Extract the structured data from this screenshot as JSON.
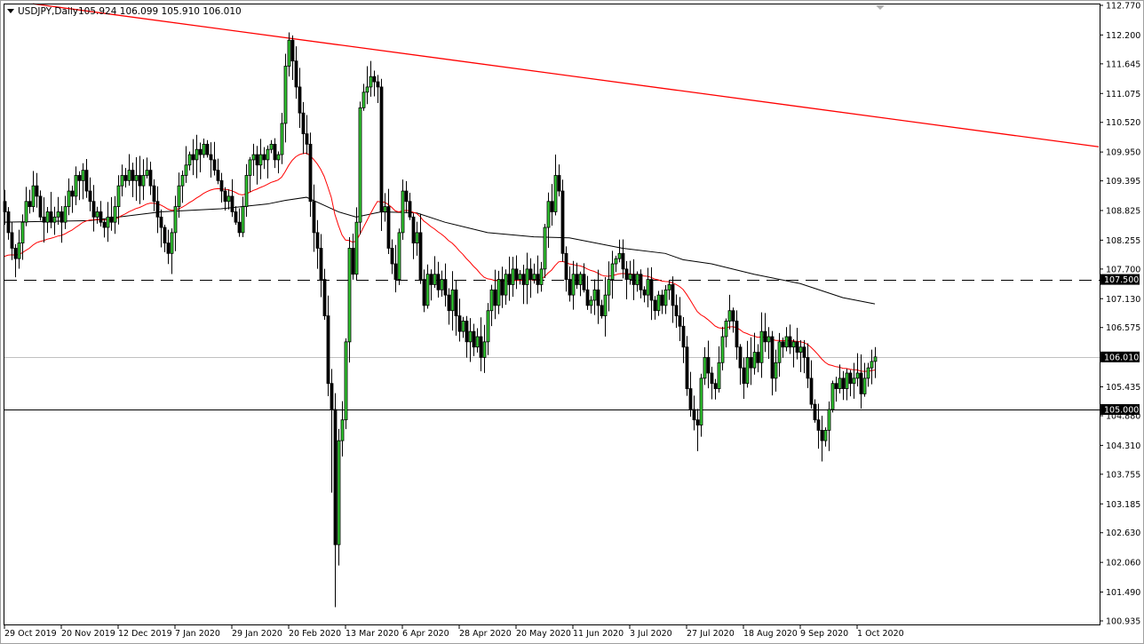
{
  "header": {
    "symbol_timeframe": "USDJPY,Daily",
    "ohlc": "105.924 106.099 105.910 106.010"
  },
  "colors": {
    "bull": "#32cd32",
    "bear": "#000000",
    "ma_fast": "#ff0000",
    "ma_slow": "#000000",
    "trendline": "#ff0000",
    "bid_line": "#c0c0c0"
  },
  "chart_data": {
    "type": "candlestick",
    "title": "USDJPY,Daily",
    "ylim": [
      100.935,
      112.77
    ],
    "y_ticks": [
      "112.770",
      "112.200",
      "111.645",
      "111.075",
      "110.520",
      "109.950",
      "109.395",
      "108.825",
      "108.255",
      "107.700",
      "107.130",
      "106.575",
      "105.435",
      "104.880",
      "104.310",
      "103.755",
      "103.185",
      "102.630",
      "102.060",
      "101.490",
      "100.935"
    ],
    "x_ticks": [
      {
        "index": 0,
        "label": "29 Oct 2019"
      },
      {
        "index": 16,
        "label": "20 Nov 2019"
      },
      {
        "index": 32,
        "label": "12 Dec 2019"
      },
      {
        "index": 48,
        "label": "7 Jan 2020"
      },
      {
        "index": 64,
        "label": "29 Jan 2020"
      },
      {
        "index": 80,
        "label": "20 Feb 2020"
      },
      {
        "index": 96,
        "label": "13 Mar 2020"
      },
      {
        "index": 112,
        "label": "6 Apr 2020"
      },
      {
        "index": 128,
        "label": "28 Apr 2020"
      },
      {
        "index": 144,
        "label": "20 May 2020"
      },
      {
        "index": 160,
        "label": "11 Jun 2020"
      },
      {
        "index": 176,
        "label": "3 Jul 2020"
      },
      {
        "index": 192,
        "label": "27 Jul 2020"
      },
      {
        "index": 208,
        "label": "18 Aug 2020"
      },
      {
        "index": 224,
        "label": "9 Sep 2020"
      },
      {
        "index": 240,
        "label": "1 Oct 2020"
      }
    ],
    "closes": [
      108.8,
      108.4,
      108.1,
      107.9,
      108.2,
      108.6,
      109.0,
      108.9,
      109.3,
      109.1,
      108.7,
      108.6,
      108.8,
      108.6,
      108.7,
      108.8,
      108.6,
      108.9,
      109.2,
      109.1,
      109.5,
      109.4,
      109.6,
      109.2,
      109.0,
      108.7,
      108.8,
      108.6,
      108.5,
      108.7,
      108.6,
      108.9,
      109.3,
      109.5,
      109.4,
      109.6,
      109.4,
      109.5,
      109.3,
      109.5,
      109.6,
      109.3,
      109.0,
      108.7,
      108.5,
      108.2,
      108.0,
      108.4,
      108.9,
      109.3,
      109.5,
      109.7,
      109.9,
      109.8,
      110.0,
      109.9,
      110.1,
      109.9,
      109.8,
      109.6,
      109.4,
      109.2,
      109.0,
      109.1,
      108.8,
      108.6,
      108.4,
      108.9,
      109.5,
      109.8,
      109.9,
      109.7,
      109.9,
      109.8,
      110.0,
      110.1,
      109.8,
      109.9,
      110.5,
      111.6,
      112.1,
      111.7,
      111.2,
      110.7,
      110.3,
      110.1,
      109.0,
      108.4,
      108.1,
      107.5,
      106.8,
      105.5,
      105.0,
      102.4,
      104.4,
      104.8,
      106.3,
      108.1,
      107.6,
      108.6,
      110.8,
      111.1,
      111.2,
      111.4,
      111.3,
      111.2,
      108.8,
      108.9,
      108.1,
      107.8,
      107.5,
      108.4,
      109.2,
      109.0,
      108.7,
      108.2,
      108.4,
      107.5,
      107.0,
      107.6,
      107.4,
      107.6,
      107.3,
      107.5,
      107.2,
      106.9,
      107.3,
      106.8,
      106.5,
      106.7,
      106.3,
      106.5,
      106.2,
      106.4,
      106.0,
      106.3,
      106.9,
      107.3,
      107.0,
      107.5,
      107.2,
      107.6,
      107.4,
      107.7,
      107.5,
      107.6,
      107.4,
      107.7,
      107.5,
      107.6,
      107.4,
      107.7,
      108.5,
      109.0,
      108.8,
      109.5,
      109.2,
      108.0,
      107.5,
      107.2,
      107.6,
      107.4,
      107.6,
      107.3,
      107.0,
      107.1,
      107.3,
      107.0,
      106.8,
      107.2,
      107.5,
      107.8,
      107.9,
      108.0,
      107.7,
      107.5,
      107.6,
      107.4,
      107.6,
      107.3,
      107.2,
      107.5,
      107.1,
      106.9,
      107.2,
      107.0,
      107.3,
      107.4,
      107.0,
      106.8,
      106.6,
      106.2,
      105.4,
      105.0,
      104.8,
      104.7,
      105.6,
      106.0,
      105.7,
      105.5,
      105.4,
      105.9,
      106.4,
      106.7,
      106.9,
      106.7,
      106.2,
      105.8,
      105.5,
      106.0,
      105.8,
      106.1,
      105.9,
      106.5,
      106.3,
      106.4,
      105.6,
      105.9,
      106.3,
      106.2,
      106.4,
      106.2,
      106.3,
      106.1,
      106.2,
      106.0,
      105.6,
      105.1,
      104.8,
      104.6,
      104.4,
      104.6,
      105.0,
      105.5,
      105.4,
      105.6,
      105.4,
      105.7,
      105.5,
      105.6,
      105.7,
      105.3,
      105.6,
      105.8,
      105.924,
      106.01
    ],
    "last_open": 105.924,
    "wick_overrides": [
      {
        "index": 80,
        "high": 112.25
      },
      {
        "index": 93,
        "low": 101.2
      },
      {
        "index": 94,
        "low": 102.0
      },
      {
        "index": 92,
        "low": 103.4
      },
      {
        "index": 103,
        "high": 111.7
      },
      {
        "index": 102,
        "high": 111.6
      },
      {
        "index": 155,
        "high": 109.9
      },
      {
        "index": 195,
        "low": 104.2
      },
      {
        "index": 230,
        "low": 104.0
      },
      {
        "index": 245,
        "high": 106.2
      }
    ],
    "ma_slow_points": [
      [
        0,
        108.6
      ],
      [
        24,
        108.63
      ],
      [
        44,
        108.8
      ],
      [
        61,
        108.86
      ],
      [
        74,
        108.95
      ],
      [
        79,
        109.02
      ],
      [
        85,
        109.08
      ],
      [
        94,
        108.8
      ],
      [
        99,
        108.7
      ],
      [
        106,
        108.8
      ],
      [
        116,
        108.78
      ],
      [
        124,
        108.6
      ],
      [
        136,
        108.4
      ],
      [
        149,
        108.32
      ],
      [
        159,
        108.3
      ],
      [
        174,
        108.1
      ],
      [
        186,
        108.0
      ],
      [
        191,
        107.88
      ],
      [
        199,
        107.8
      ],
      [
        211,
        107.6
      ],
      [
        224,
        107.42
      ],
      [
        236,
        107.15
      ],
      [
        245,
        107.03
      ]
    ],
    "ma_fast_period": 40,
    "ma_fast_seed": 107.9,
    "trendline": [
      [
        8,
        112.8
      ],
      [
        308,
        110.05
      ]
    ],
    "levels": [
      {
        "name": "resistance",
        "price": 107.5,
        "label": "107.500",
        "style": "dashed"
      },
      {
        "name": "bid",
        "price": 106.01,
        "label": "106.010",
        "style": "bid"
      },
      {
        "name": "support",
        "price": 105.0,
        "label": "105.000",
        "style": "solid"
      }
    ]
  }
}
